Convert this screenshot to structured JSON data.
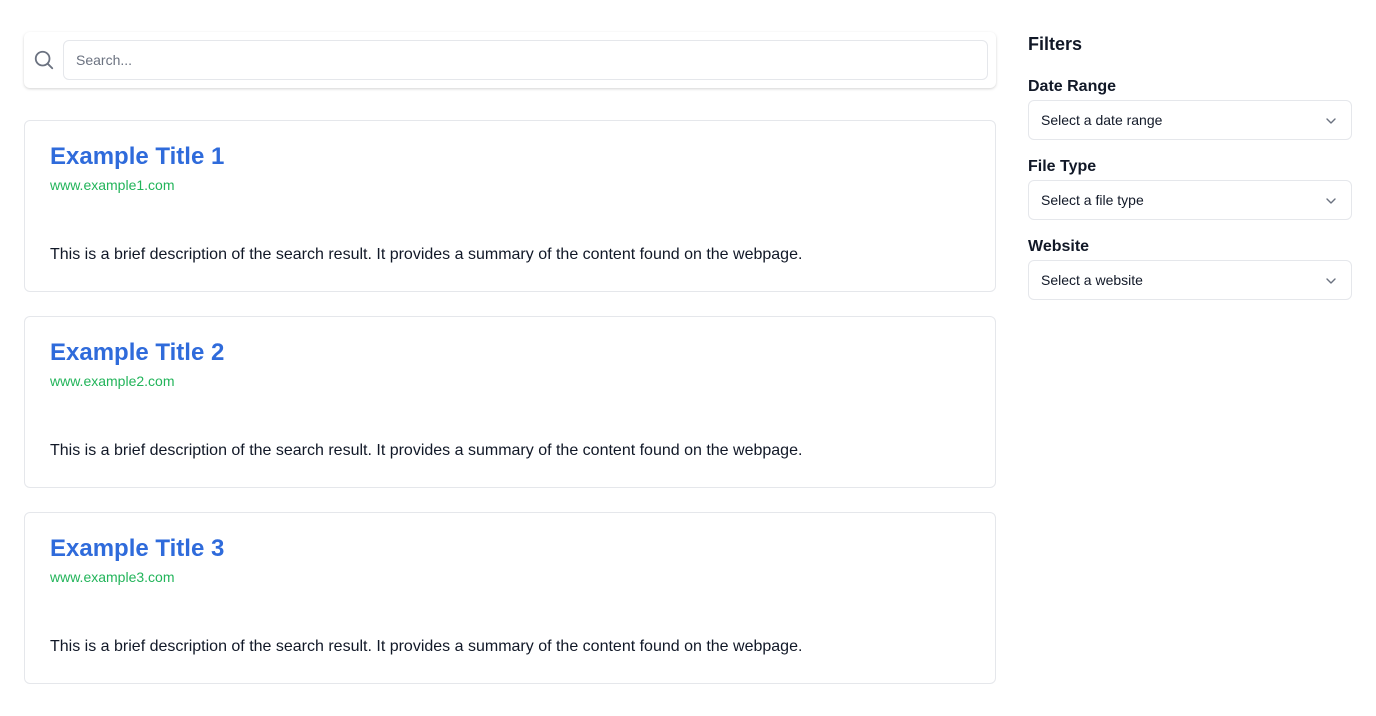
{
  "search": {
    "placeholder": "Search...",
    "value": ""
  },
  "results": [
    {
      "title": "Example Title 1",
      "url": "www.example1.com",
      "description": "This is a brief description of the search result. It provides a summary of the content found on the webpage."
    },
    {
      "title": "Example Title 2",
      "url": "www.example2.com",
      "description": "This is a brief description of the search result. It provides a summary of the content found on the webpage."
    },
    {
      "title": "Example Title 3",
      "url": "www.example3.com",
      "description": "This is a brief description of the search result. It provides a summary of the content found on the webpage."
    }
  ],
  "filters": {
    "heading": "Filters",
    "date_range": {
      "label": "Date Range",
      "placeholder": "Select a date range"
    },
    "file_type": {
      "label": "File Type",
      "placeholder": "Select a file type"
    },
    "website": {
      "label": "Website",
      "placeholder": "Select a website"
    }
  },
  "colors": {
    "title_link": "#2f6bdb",
    "url": "#22b45a",
    "border": "#e5e7eb",
    "text": "#111827"
  },
  "icons": {
    "search": "search-icon",
    "dropdown": "chevron-down-icon"
  }
}
